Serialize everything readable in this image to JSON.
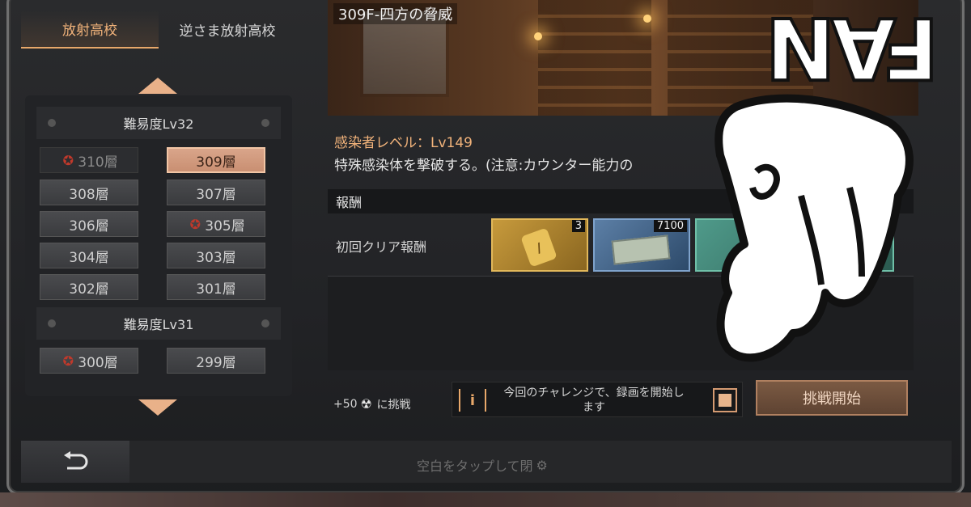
{
  "tabs": [
    "放射高校",
    "逆さま放射高校"
  ],
  "difficulty_groups": [
    {
      "label": "難易度Lv32",
      "floors": [
        {
          "label": "310層",
          "state": "locked",
          "boss": true
        },
        {
          "label": "309層",
          "state": "selected",
          "boss": false
        },
        {
          "label": "308層",
          "state": "normal",
          "boss": false
        },
        {
          "label": "307層",
          "state": "normal",
          "boss": false
        },
        {
          "label": "306層",
          "state": "normal",
          "boss": false
        },
        {
          "label": "305層",
          "state": "normal",
          "boss": true
        },
        {
          "label": "304層",
          "state": "normal",
          "boss": false
        },
        {
          "label": "303層",
          "state": "normal",
          "boss": false
        },
        {
          "label": "302層",
          "state": "normal",
          "boss": false
        },
        {
          "label": "301層",
          "state": "normal",
          "boss": false
        }
      ]
    },
    {
      "label": "難易度Lv31",
      "floors": [
        {
          "label": "300層",
          "state": "normal",
          "boss": true
        },
        {
          "label": "299層",
          "state": "normal",
          "boss": false
        }
      ]
    }
  ],
  "stage": {
    "title": "309F-四方の脅威",
    "level_text": "感染者レベル：Lv149",
    "description": "特殊感染体を撃破する。(注意:カウンター能力の",
    "desc_tail": "]"
  },
  "reward": {
    "header": "報酬",
    "row_label": "初回クリア報酬",
    "items": [
      {
        "icon": "dog-tag-icon",
        "qty": "3"
      },
      {
        "icon": "cash-stack-icon",
        "qty": "7100"
      },
      {
        "icon": "reward-item-icon",
        "qty": ""
      }
    ]
  },
  "challenge": {
    "plus_text": "+50",
    "suffix": "に挑戦",
    "record_text": "今回のチャレンジで、録画を開始します",
    "info_glyph": "i",
    "start_label": "挑戦開始"
  },
  "footer": {
    "tap_close": "空白をタップして閉"
  },
  "overlay": {
    "fan_text": "FAN"
  },
  "colors": {
    "accent": "#e8a86a",
    "selected": "#d9a58a",
    "boss": "#c0392b"
  }
}
